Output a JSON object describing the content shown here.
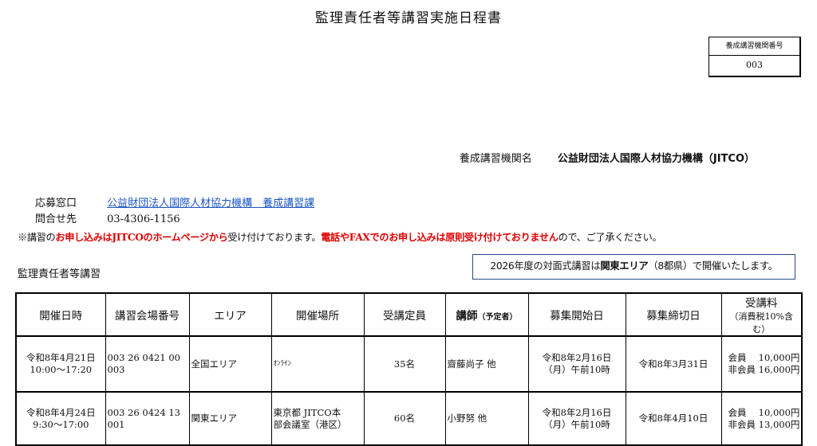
{
  "title": "監理責任者等講習実施日程書",
  "code_box": {
    "label": "養成講習機関番号",
    "value": "003"
  },
  "org": {
    "label": "養成講習機関名",
    "name": "公益財団法人国際人材協力機構（JITCO）"
  },
  "contact": {
    "window_label": "応募窓口",
    "window_link": "公益財団法人国際人材協力機構　養成講習課",
    "inquiry_label": "問合せ先",
    "inquiry_value": "03-4306-1156"
  },
  "notice": {
    "p1": "※講習の",
    "p2": "お申し込みはJITCOのホームページから",
    "p3": "受け付けております。",
    "p4": "電話やFAXでのお申し込みは原則受け付けておりません",
    "p5": "ので、ご了承ください。"
  },
  "section_title": "監理責任者等講習",
  "announcement": {
    "p1": "2026年度の対面式講習は",
    "p2": "関東エリア",
    "p3": "（8都県）で開催いたします。"
  },
  "table": {
    "headers": [
      "開催日時",
      "講習会場番号",
      "エリア",
      "開催場所",
      "受講定員",
      "講師",
      "募集開始日",
      "募集締切日",
      "受講料"
    ],
    "header_sub": {
      "lecturer": "（予定者）",
      "fee": "（消費税10%含む）"
    },
    "rows": [
      {
        "date": "令和8年4月21日",
        "time": "10:00～17:20",
        "venue_no_1": "003 26 0421 00",
        "venue_no_2": "003",
        "area": "全国エリア",
        "place_1": "ｵﾝﾗｲﾝ",
        "place_2": "",
        "capacity": "35名",
        "lecturer": "齋藤尚子 他",
        "start_1": "令和8年2月16日",
        "start_2": "（月）午前10時",
        "deadline": "令和8年3月31日",
        "fee_1": "会員　 10,000円",
        "fee_2": "非会員 16,000円"
      },
      {
        "date": "令和8年4月24日",
        "time": "9:30～17:00",
        "venue_no_1": "003 26 0424 13",
        "venue_no_2": "001",
        "area": "関東エリア",
        "place_1": "東京都 JITCO本",
        "place_2": "部会議室（港区）",
        "capacity": "60名",
        "lecturer": "小野努 他",
        "start_1": "令和8年2月16日",
        "start_2": "（月）午前10時",
        "deadline": "令和8年4月10日",
        "fee_1": "会員　 10,000円",
        "fee_2": "非会員 13,000円"
      }
    ]
  },
  "colors": {
    "link": "#1a56c4",
    "emphasis": "#e00000",
    "announce_border": "#2a4a8a"
  }
}
